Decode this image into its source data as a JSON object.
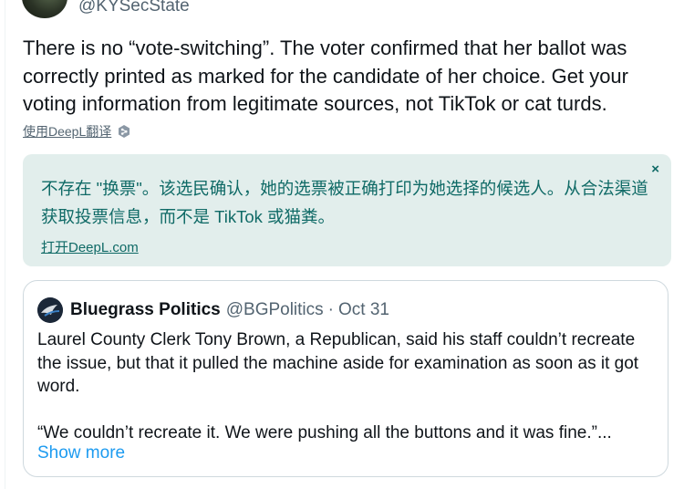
{
  "author": {
    "handle": "@KYSecState"
  },
  "tweet": {
    "text": "There is no “vote-switching”. The voter confirmed that her ballot was correctly printed as marked for the candidate of her choice. Get your voting information from legitimate sources, not TikTok or cat turds."
  },
  "translate": {
    "link_label": "使用DeepL翻译",
    "icon": "deepl-icon"
  },
  "translation_box": {
    "text": "不存在 \"换票\"。该选民确认，她的选票被正确打印为她选择的候选人。从合法渠道获取投票信息，而不是 TikTok 或猫粪。",
    "open_link": "打开DeepL.com",
    "close_label": "×",
    "colors": {
      "background": "#e2eeec",
      "text": "#0f6a66"
    }
  },
  "quote": {
    "name": "Bluegrass Politics",
    "handle": "@BGPolitics",
    "separator": "·",
    "date": "Oct 31",
    "paragraph1": "Laurel County Clerk Tony Brown, a Republican, said his staff couldn’t recreate the issue, but that it pulled the machine aside for examination as soon as it got word.",
    "paragraph2": "“We couldn’t recreate it. We were pushing all the buttons and it was fine.”...",
    "show_more": "Show more"
  },
  "colors": {
    "link_blue": "#1d9bf0",
    "secondary_text": "#536471",
    "border": "#cfd9de"
  }
}
